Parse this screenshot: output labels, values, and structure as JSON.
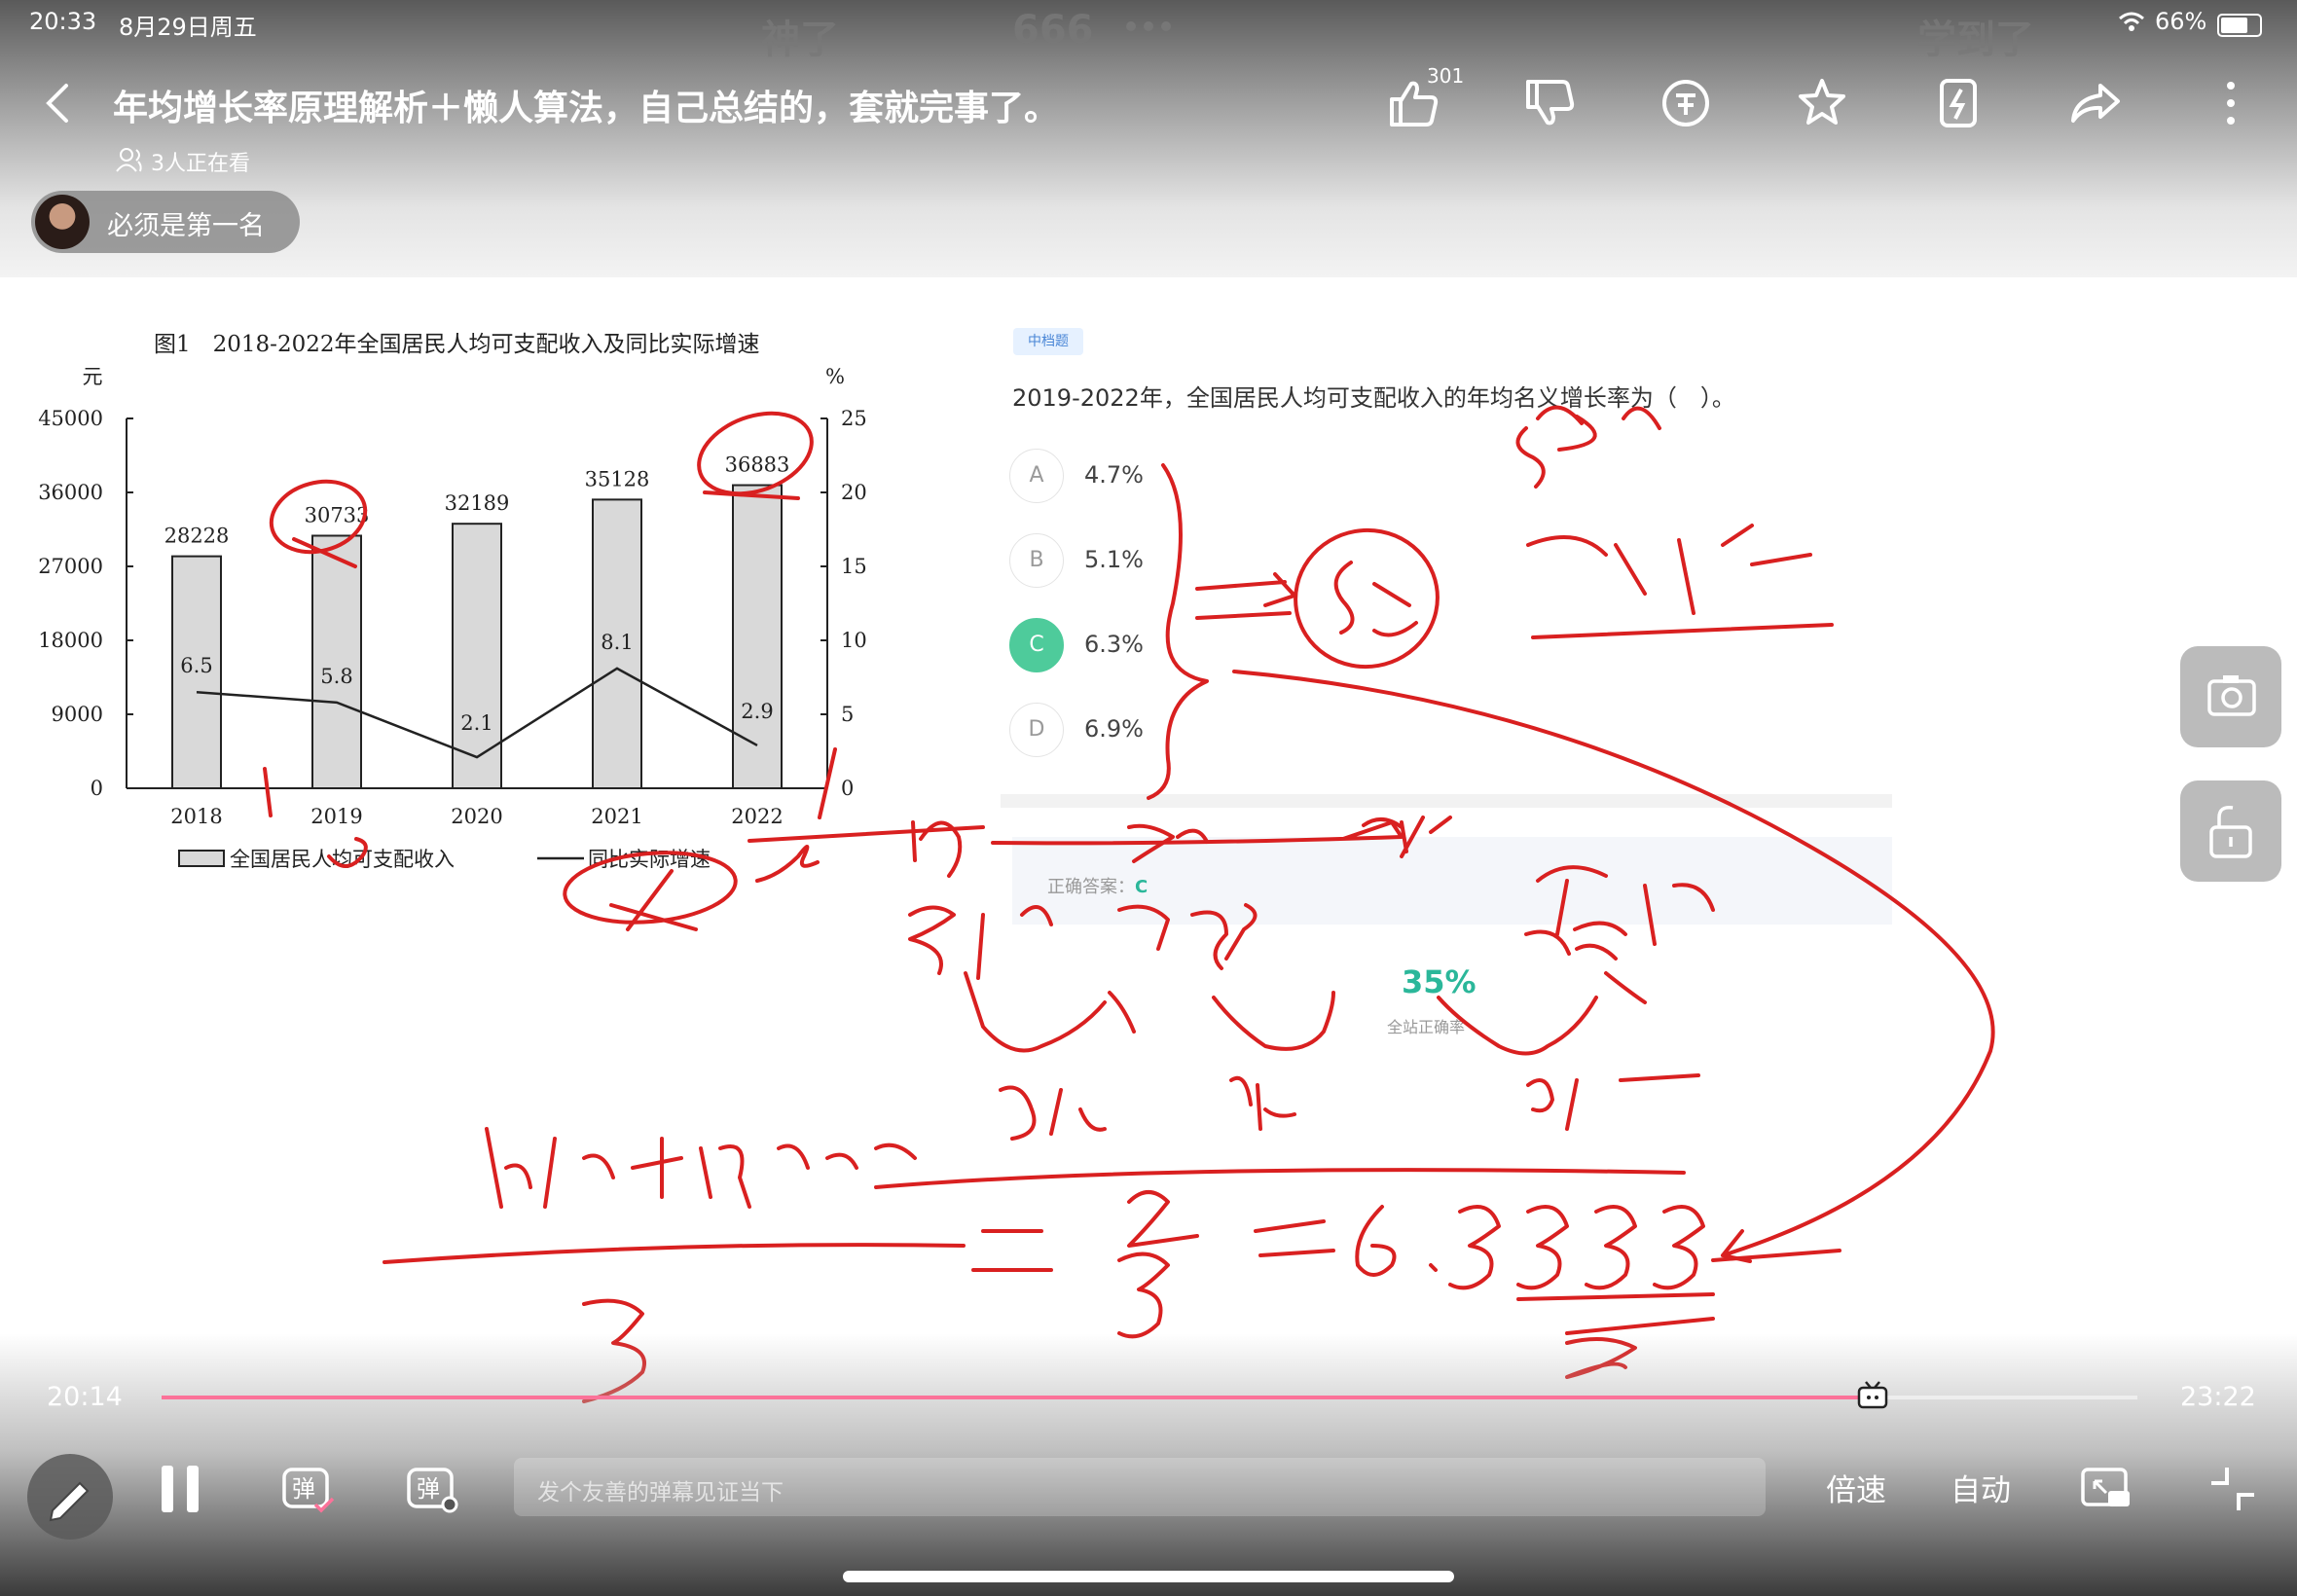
{
  "status_bar": {
    "time": "20:33",
    "date": "8月29日周五",
    "battery": "66%"
  },
  "danmaku": [
    "神了",
    "666",
    "学到了"
  ],
  "header": {
    "title": "年均增长率原理解析＋懒人算法，自己总结的，套就完事了。",
    "viewers": "3人正在看",
    "uploader": "必须是第一名",
    "like_count": "301"
  },
  "chart_data": {
    "type": "bar",
    "title": "图1　2018-2022年全国居民人均可支配收入及同比实际增速",
    "categories": [
      "2018",
      "2019",
      "2020",
      "2021",
      "2022"
    ],
    "series": [
      {
        "name": "全国居民人均可支配收入",
        "type": "bar",
        "axis": "left",
        "values": [
          28228,
          30733,
          32189,
          35128,
          36883
        ]
      },
      {
        "name": "同比实际增速",
        "type": "line",
        "axis": "right",
        "values": [
          6.5,
          5.8,
          2.1,
          8.1,
          2.9
        ]
      }
    ],
    "bar_labels": [
      "28228",
      "30733",
      "32189",
      "35128",
      "36883"
    ],
    "line_labels": [
      "6.5",
      "5.8",
      "2.1",
      "8.1",
      "2.9"
    ],
    "ylabel_left": "元",
    "ylabel_right": "%",
    "ylim_left": [
      0,
      45000
    ],
    "ylim_right": [
      0,
      25
    ],
    "yticks_left": [
      "0",
      "9000",
      "18000",
      "27000",
      "36000",
      "45000"
    ],
    "yticks_right": [
      "0",
      "5",
      "10",
      "15",
      "20",
      "25"
    ],
    "legend": [
      "全国居民人均可支配收入",
      "同比实际增速"
    ],
    "legend_position": "bottom",
    "grid": false
  },
  "question": {
    "tag": "中档题",
    "text": "2019-2022年，全国居民人均可支配收入的年均名义增长率为（　）。",
    "options": [
      {
        "letter": "A",
        "text": "4.7%"
      },
      {
        "letter": "B",
        "text": "5.1%"
      },
      {
        "letter": "C",
        "text": "6.3%"
      },
      {
        "letter": "D",
        "text": "6.9%"
      }
    ],
    "selected": "C",
    "answer_label": "正确答案：",
    "answer_value": "C",
    "rate": "35%",
    "rate_label": "全站正确率",
    "accent_color": "#4ecb9b"
  },
  "annotations": {
    "ink_color": "#d92020",
    "texts": [
      "5%",
      "错位一伸",
      "19",
      "20",
      "21",
      "22",
      "307",
      "322",
      "339",
      "339",
      "309",
      "5%",
      "5%",
      "9%",
      "5%+5%+9%",
      "3",
      "19",
      "3",
      "6.3333"
    ]
  },
  "player": {
    "current_time": "20:14",
    "total_time": "23:22",
    "progress": 0.866,
    "progress_color": "#fb7299",
    "danmaku_placeholder": "发个友善的弹幕见证当下",
    "speed_label": "倍速",
    "auto_label": "自动"
  }
}
